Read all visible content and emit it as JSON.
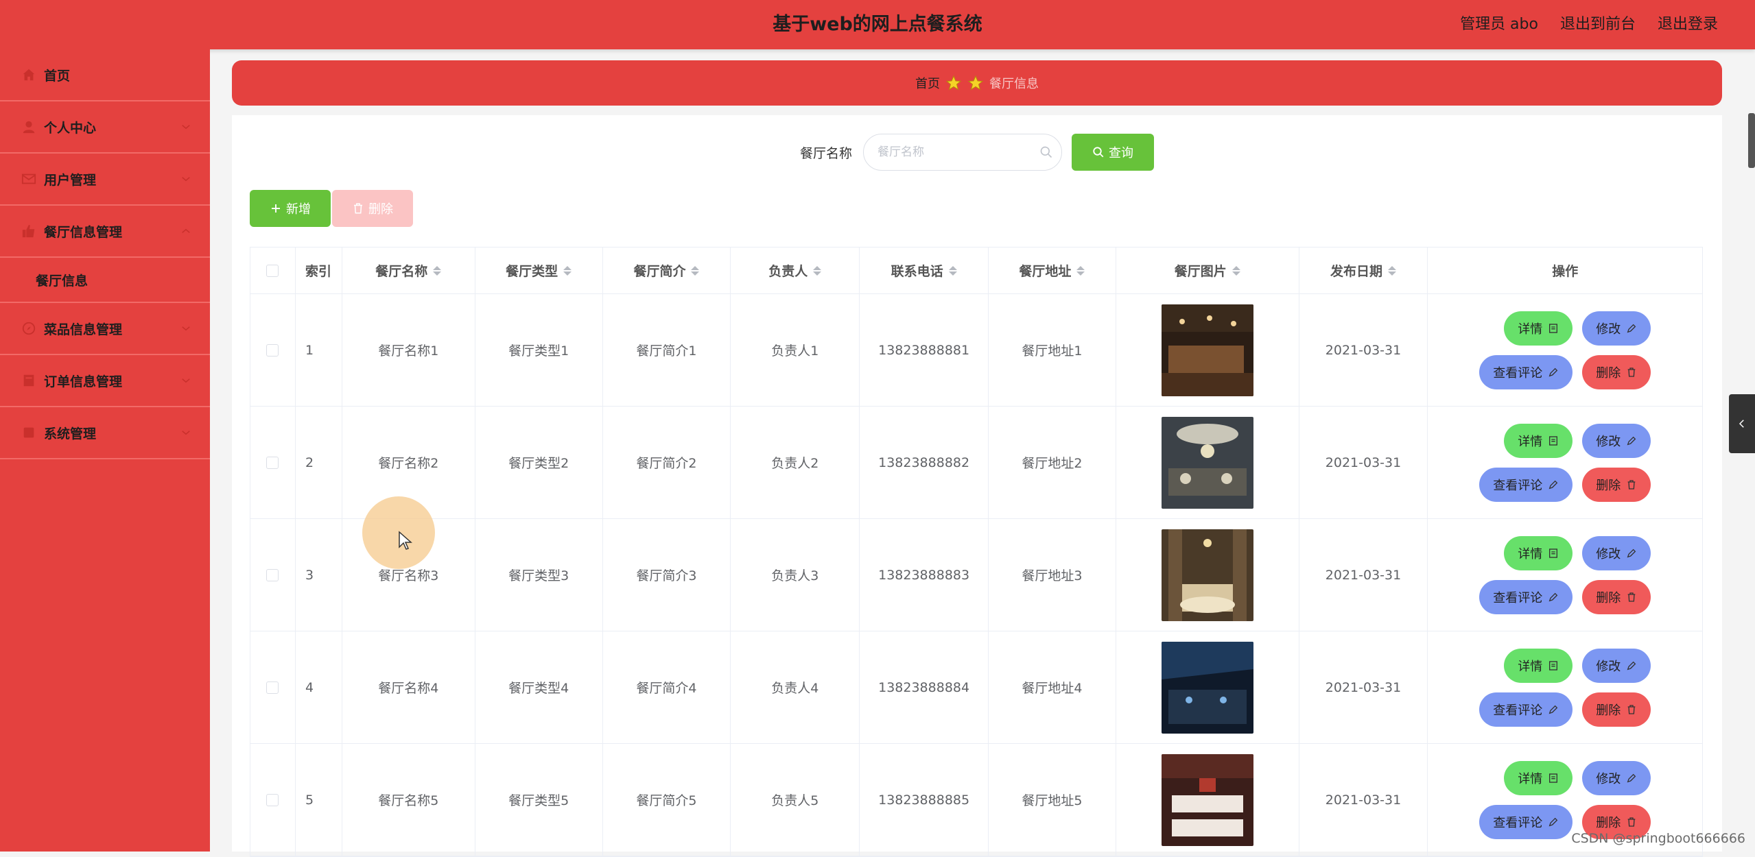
{
  "header": {
    "title": "基于web的网上点餐系统",
    "user_label": "管理员 abo",
    "exit_front_label": "退出到前台",
    "logout_label": "退出登录"
  },
  "sidebar": {
    "items": [
      {
        "label": "首页",
        "icon": "home-icon"
      },
      {
        "label": "个人中心",
        "icon": "user-icon"
      },
      {
        "label": "用户管理",
        "icon": "mail-icon"
      },
      {
        "label": "餐厅信息管理",
        "icon": "thumb-icon",
        "expanded": true,
        "children": [
          {
            "label": "餐厅信息"
          }
        ]
      },
      {
        "label": "菜品信息管理",
        "icon": "compass-icon"
      },
      {
        "label": "订单信息管理",
        "icon": "doc-icon"
      },
      {
        "label": "系统管理",
        "icon": "gear-icon"
      }
    ]
  },
  "breadcrumb": {
    "home": "首页",
    "current": "餐厅信息"
  },
  "search": {
    "label": "餐厅名称",
    "placeholder": "餐厅名称",
    "query_label": "查询"
  },
  "toolbar": {
    "add_label": "新增",
    "delete_label": "删除"
  },
  "table": {
    "columns": [
      "索引",
      "餐厅名称",
      "餐厅类型",
      "餐厅简介",
      "负责人",
      "联系电话",
      "餐厅地址",
      "餐厅图片",
      "发布日期",
      "操作"
    ],
    "rows": [
      {
        "index": "1",
        "name": "餐厅名称1",
        "type": "餐厅类型1",
        "intro": "餐厅简介1",
        "owner": "负责人1",
        "phone": "13823888881",
        "address": "餐厅地址1",
        "date": "2021-03-31"
      },
      {
        "index": "2",
        "name": "餐厅名称2",
        "type": "餐厅类型2",
        "intro": "餐厅简介2",
        "owner": "负责人2",
        "phone": "13823888882",
        "address": "餐厅地址2",
        "date": "2021-03-31"
      },
      {
        "index": "3",
        "name": "餐厅名称3",
        "type": "餐厅类型3",
        "intro": "餐厅简介3",
        "owner": "负责人3",
        "phone": "13823888883",
        "address": "餐厅地址3",
        "date": "2021-03-31"
      },
      {
        "index": "4",
        "name": "餐厅名称4",
        "type": "餐厅类型4",
        "intro": "餐厅简介4",
        "owner": "负责人4",
        "phone": "13823888884",
        "address": "餐厅地址4",
        "date": "2021-03-31"
      },
      {
        "index": "5",
        "name": "餐厅名称5",
        "type": "餐厅类型5",
        "intro": "餐厅简介5",
        "owner": "负责人5",
        "phone": "13823888885",
        "address": "餐厅地址5",
        "date": "2021-03-31"
      }
    ],
    "ops": {
      "detail": "详情",
      "edit": "修改",
      "review": "查看评论",
      "delete": "删除"
    }
  },
  "watermark": "CSDN @springboot666666",
  "colors": {
    "brand_red": "#e4413f",
    "green": "#67c23a",
    "blue_btn": "#7c97f2",
    "red_btn": "#f05a5a"
  }
}
